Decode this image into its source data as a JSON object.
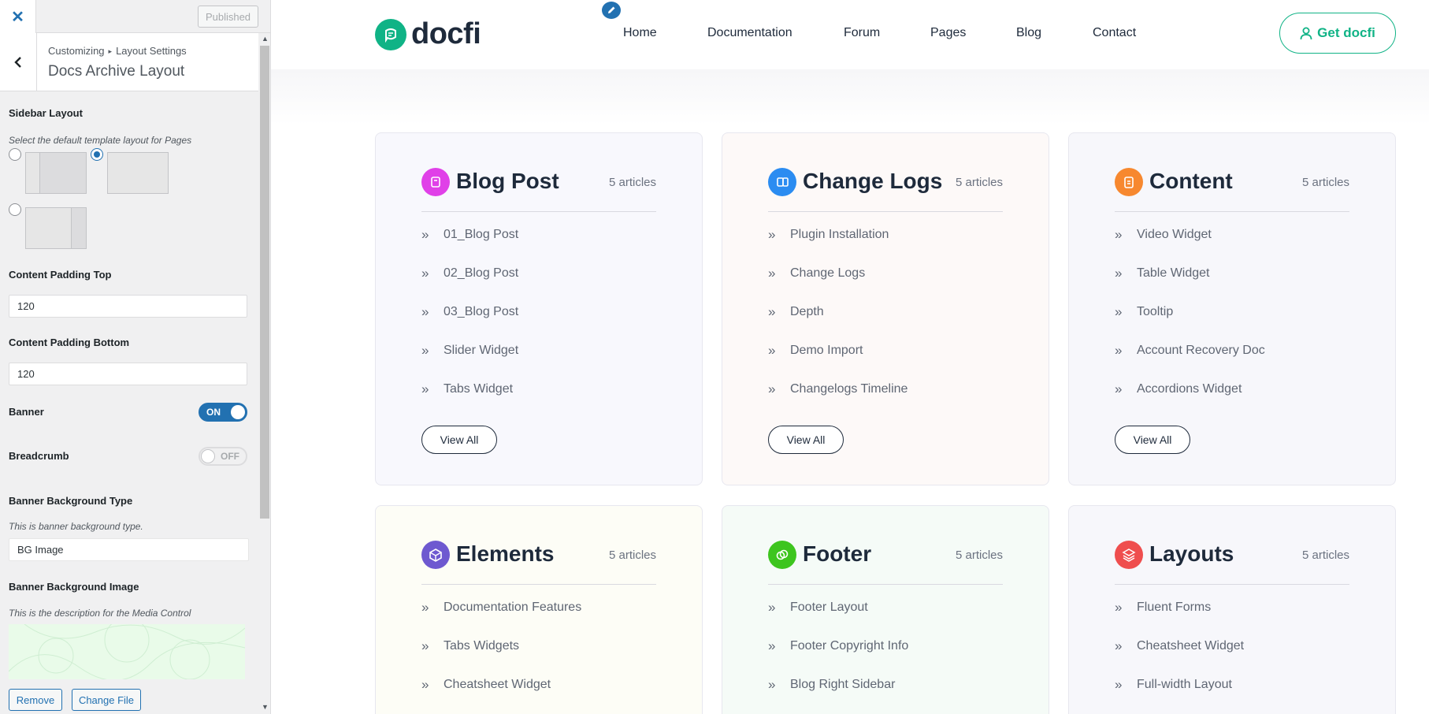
{
  "customizer": {
    "close_icon": "close-icon",
    "publish_label": "Published",
    "breadcrumb": {
      "root": "Customizing",
      "section": "Layout Settings"
    },
    "section_title": "Docs Archive Layout",
    "sidebar_layout": {
      "label": "Sidebar Layout",
      "description": "Select the default template layout for Pages",
      "selected_option": 2
    },
    "padding_top": {
      "label": "Content Padding Top",
      "value": "120"
    },
    "padding_bottom": {
      "label": "Content Padding Bottom",
      "value": "120"
    },
    "banner": {
      "label": "Banner",
      "toggle": "ON"
    },
    "breadcrumb_toggle": {
      "label": "Breadcrumb",
      "toggle": "OFF"
    },
    "banner_bg_type": {
      "label": "Banner Background Type",
      "description": "This is banner background type.",
      "value": "BG Image"
    },
    "banner_bg_image": {
      "label": "Banner Background Image",
      "description": "This is the description for the Media Control"
    },
    "remove_label": "Remove",
    "change_file_label": "Change File"
  },
  "site": {
    "brand": "docfi",
    "nav": [
      "Home",
      "Documentation",
      "Forum",
      "Pages",
      "Blog",
      "Contact"
    ],
    "cta": "Get docfi",
    "view_all_label": "View All",
    "colors": {
      "brand": "#10b386",
      "heading": "#1e2a3b"
    },
    "categories": [
      {
        "title": "Blog Post",
        "count": "5 articles",
        "icon_color": "#e040e8",
        "bg": "#f8f8fd",
        "items": [
          "01_Blog Post",
          "02_Blog Post",
          "03_Blog Post",
          "Slider Widget",
          "Tabs Widget"
        ]
      },
      {
        "title": "Change Logs",
        "count": "5 articles",
        "icon_color": "#2b8cf1",
        "bg": "#fdf9f8",
        "items": [
          "Plugin Installation",
          "Change Logs",
          "Depth",
          "Demo Import",
          "Changelogs Timeline"
        ]
      },
      {
        "title": "Content",
        "count": "5 articles",
        "icon_color": "#f7882f",
        "bg": "#f7f7fb",
        "items": [
          "Video Widget",
          "Table Widget",
          "Tooltip",
          "Account Recovery Doc",
          "Accordions Widget"
        ]
      },
      {
        "title": "Elements",
        "count": "5 articles",
        "icon_color": "#6e59d0",
        "bg": "#fdfdf6",
        "items": [
          "Documentation Features",
          "Tabs Widgets",
          "Cheatsheet Widget"
        ]
      },
      {
        "title": "Footer",
        "count": "5 articles",
        "icon_color": "#3dc51e",
        "bg": "#f5fbf7",
        "items": [
          "Footer Layout",
          "Footer Copyright Info",
          "Blog Right Sidebar"
        ]
      },
      {
        "title": "Layouts",
        "count": "5 articles",
        "icon_color": "#ef4e4e",
        "bg": "#f7f7fb",
        "items": [
          "Fluent Forms",
          "Cheatsheet Widget",
          "Full-width Layout"
        ]
      }
    ]
  }
}
